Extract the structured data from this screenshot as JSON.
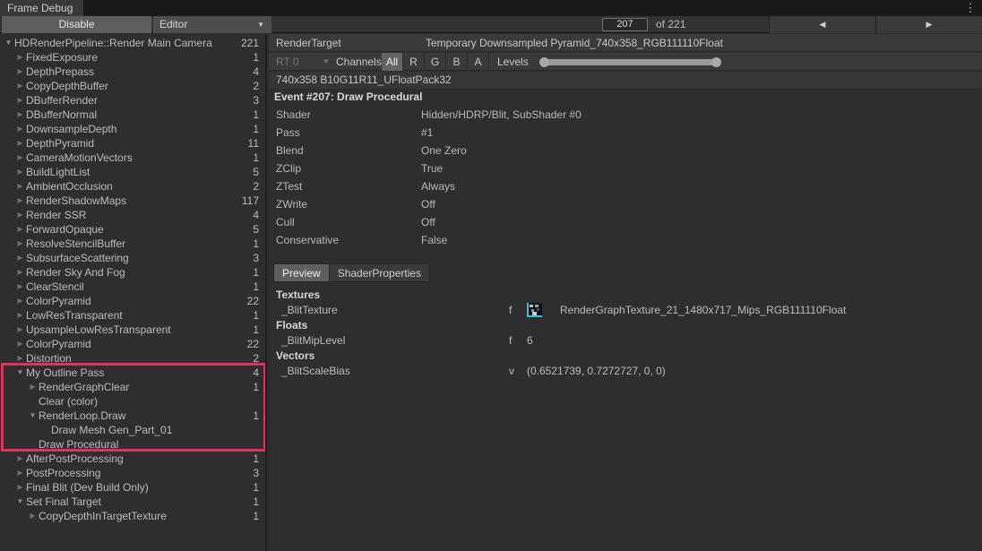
{
  "window": {
    "title": "Frame Debug"
  },
  "icons": {
    "kebab": "⋮",
    "dropdown_arrow": "▼",
    "tree_expanded": "▼",
    "tree_collapsed": "▶",
    "prev": "◀",
    "next": "▶"
  },
  "toolbar": {
    "disable_label": "Disable",
    "mode_dropdown_value": "Editor",
    "frame_value": "207",
    "frame_total_label": "of 221",
    "frame_total": 221,
    "slider_fraction": 0.937
  },
  "tree": {
    "highlight_color": "#ee2b5b",
    "items": [
      {
        "label": "HDRenderPipeline::Render Main Camera",
        "count": "221",
        "level": 0,
        "arrow": "open"
      },
      {
        "label": "FixedExposure",
        "count": "1",
        "level": 1,
        "arrow": "closed"
      },
      {
        "label": "DepthPrepass",
        "count": "4",
        "level": 1,
        "arrow": "closed"
      },
      {
        "label": "CopyDepthBuffer",
        "count": "2",
        "level": 1,
        "arrow": "closed"
      },
      {
        "label": "DBufferRender",
        "count": "3",
        "level": 1,
        "arrow": "closed"
      },
      {
        "label": "DBufferNormal",
        "count": "1",
        "level": 1,
        "arrow": "closed"
      },
      {
        "label": "DownsampleDepth",
        "count": "1",
        "level": 1,
        "arrow": "closed"
      },
      {
        "label": "DepthPyramid",
        "count": "11",
        "level": 1,
        "arrow": "closed"
      },
      {
        "label": "CameraMotionVectors",
        "count": "1",
        "level": 1,
        "arrow": "closed"
      },
      {
        "label": "BuildLightList",
        "count": "5",
        "level": 1,
        "arrow": "closed"
      },
      {
        "label": "AmbientOcclusion",
        "count": "2",
        "level": 1,
        "arrow": "closed"
      },
      {
        "label": "RenderShadowMaps",
        "count": "117",
        "level": 1,
        "arrow": "closed"
      },
      {
        "label": "Render SSR",
        "count": "4",
        "level": 1,
        "arrow": "closed"
      },
      {
        "label": "ForwardOpaque",
        "count": "5",
        "level": 1,
        "arrow": "closed"
      },
      {
        "label": "ResolveStencilBuffer",
        "count": "1",
        "level": 1,
        "arrow": "closed"
      },
      {
        "label": "SubsurfaceScattering",
        "count": "3",
        "level": 1,
        "arrow": "closed"
      },
      {
        "label": "Render Sky And Fog",
        "count": "1",
        "level": 1,
        "arrow": "closed"
      },
      {
        "label": "ClearStencil",
        "count": "1",
        "level": 1,
        "arrow": "closed"
      },
      {
        "label": "ColorPyramid",
        "count": "22",
        "level": 1,
        "arrow": "closed"
      },
      {
        "label": "LowResTransparent",
        "count": "1",
        "level": 1,
        "arrow": "closed"
      },
      {
        "label": "UpsampleLowResTransparent",
        "count": "1",
        "level": 1,
        "arrow": "closed"
      },
      {
        "label": "ColorPyramid",
        "count": "22",
        "level": 1,
        "arrow": "closed"
      },
      {
        "label": "Distortion",
        "count": "2",
        "level": 1,
        "arrow": "closed"
      },
      {
        "label": "My Outline Pass",
        "count": "4",
        "level": 1,
        "arrow": "open"
      },
      {
        "label": "RenderGraphClear",
        "count": "1",
        "level": 2,
        "arrow": "closed"
      },
      {
        "label": "Clear (color)",
        "count": "",
        "level": 2,
        "arrow": "none"
      },
      {
        "label": "RenderLoop.Draw",
        "count": "1",
        "level": 2,
        "arrow": "open"
      },
      {
        "label": "Draw Mesh Gen_Part_01",
        "count": "",
        "level": 3,
        "arrow": "none"
      },
      {
        "label": "Draw Procedural",
        "count": "",
        "level": 2,
        "arrow": "none"
      },
      {
        "label": "AfterPostProcessing",
        "count": "1",
        "level": 1,
        "arrow": "closed"
      },
      {
        "label": "PostProcessing",
        "count": "3",
        "level": 1,
        "arrow": "closed"
      },
      {
        "label": "Final Blit (Dev Build Only)",
        "count": "1",
        "level": 1,
        "arrow": "closed"
      },
      {
        "label": "Set Final Target",
        "count": "1",
        "level": 1,
        "arrow": "open"
      },
      {
        "label": "CopyDepthInTargetTexture",
        "count": "1",
        "level": 2,
        "arrow": "closed"
      }
    ]
  },
  "details": {
    "render_target_label": "RenderTarget",
    "render_target_value": "Temporary Downsampled Pyramid_740x358_RGB111110Float",
    "channels_row": {
      "rt_label": "RT 0",
      "channels_label": "Channels",
      "channel_buttons": [
        "All",
        "R",
        "G",
        "B",
        "A"
      ],
      "selected_channel": "All",
      "levels_label": "Levels"
    },
    "texture_info": "740x358 B10G11R11_UFloatPack32",
    "event_title": "Event #207: Draw Procedural",
    "properties": [
      {
        "name": "Shader",
        "value": "Hidden/HDRP/Blit, SubShader #0"
      },
      {
        "name": "Pass",
        "value": "#1"
      },
      {
        "name": "Blend",
        "value": "One Zero"
      },
      {
        "name": "ZClip",
        "value": "True"
      },
      {
        "name": "ZTest",
        "value": "Always"
      },
      {
        "name": "ZWrite",
        "value": "Off"
      },
      {
        "name": "Cull",
        "value": "Off"
      },
      {
        "name": "Conservative",
        "value": "False"
      }
    ],
    "tabs": [
      "Preview",
      "ShaderProperties"
    ],
    "active_tab": "Preview",
    "shader_props": {
      "sections": [
        {
          "title": "Textures",
          "rows": [
            {
              "name": "_BlitTexture",
              "flag": "f",
              "has_thumb": true,
              "value": "RenderGraphTexture_21_1480x717_Mips_RGB111110Float"
            }
          ]
        },
        {
          "title": "Floats",
          "rows": [
            {
              "name": "_BlitMipLevel",
              "flag": "f",
              "has_thumb": false,
              "value": "6"
            }
          ]
        },
        {
          "title": "Vectors",
          "rows": [
            {
              "name": "_BlitScaleBias",
              "flag": "v",
              "has_thumb": false,
              "value": "(0.6521739, 0.7272727, 0, 0)"
            }
          ]
        }
      ]
    }
  }
}
